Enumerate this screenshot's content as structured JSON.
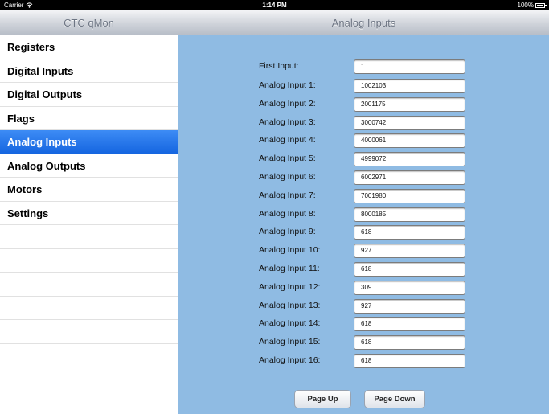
{
  "status": {
    "carrier": "Carrier",
    "time": "1:14 PM",
    "battery": "100%"
  },
  "master": {
    "title": "CTC qMon",
    "items": [
      {
        "label": "Registers"
      },
      {
        "label": "Digital Inputs"
      },
      {
        "label": "Digital Outputs"
      },
      {
        "label": "Flags"
      },
      {
        "label": "Analog Inputs",
        "selected": true
      },
      {
        "label": "Analog Outputs"
      },
      {
        "label": "Motors"
      },
      {
        "label": "Settings"
      }
    ]
  },
  "detail": {
    "title": "Analog Inputs",
    "first_input": {
      "label": "First Input:",
      "value": "1"
    },
    "inputs": [
      {
        "label": "Analog Input 1:",
        "value": "1002103"
      },
      {
        "label": "Analog Input 2:",
        "value": "2001175"
      },
      {
        "label": "Analog Input 3:",
        "value": "3000742"
      },
      {
        "label": "Analog Input 4:",
        "value": "4000061"
      },
      {
        "label": "Analog Input 5:",
        "value": "4999072"
      },
      {
        "label": "Analog Input 6:",
        "value": "6002971"
      },
      {
        "label": "Analog Input 7:",
        "value": "7001980"
      },
      {
        "label": "Analog Input 8:",
        "value": "8000185"
      },
      {
        "label": "Analog Input 9:",
        "value": "618"
      },
      {
        "label": "Analog Input 10:",
        "value": "927"
      },
      {
        "label": "Analog Input 11:",
        "value": "618"
      },
      {
        "label": "Analog Input 12:",
        "value": "309"
      },
      {
        "label": "Analog Input 13:",
        "value": "927"
      },
      {
        "label": "Analog Input 14:",
        "value": "618"
      },
      {
        "label": "Analog Input 15:",
        "value": "618"
      },
      {
        "label": "Analog Input 16:",
        "value": "618"
      }
    ],
    "page_up_label": "Page Up",
    "page_down_label": "Page Down"
  },
  "colors": {
    "selected_row": "#1a6ae6",
    "detail_background": "#8fbbe3"
  }
}
